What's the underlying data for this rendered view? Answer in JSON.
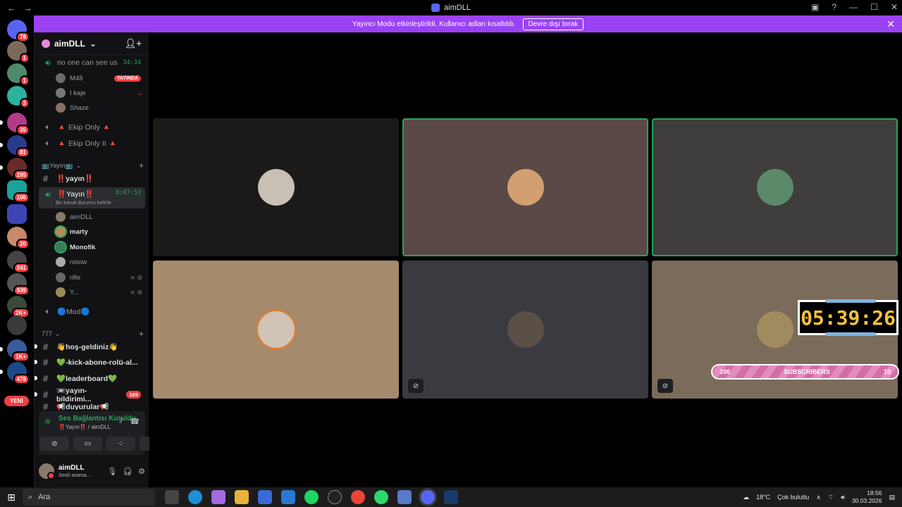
{
  "window": {
    "title": "aimDLL",
    "back": "←",
    "forward": "→",
    "controls": [
      "▣",
      "?",
      "—",
      "☐",
      "✕"
    ]
  },
  "banner": {
    "message": "Yayıncı Modu etkinleştirildi. Kullanıcı adları kısaltıldı.",
    "button": "Devre dışı bırak",
    "close": "✕"
  },
  "servers": {
    "badges": [
      "78",
      "1",
      "1",
      "3",
      "35",
      "81",
      "295",
      "106",
      "20",
      "241",
      "939",
      "2K+",
      "1K+",
      "478"
    ],
    "new_label": "YENİ"
  },
  "guild": {
    "name": "aimDLL",
    "chevron": "⌄",
    "invite_icon": "person-add-icon"
  },
  "channels": {
    "voice1": {
      "name": "no one can see us",
      "timer": "34:34"
    },
    "voice1_users": [
      {
        "name": "M48",
        "live": "YAYINDA"
      },
      {
        "name": "I kaje"
      },
      {
        "name": "Shaze"
      }
    ],
    "voice2": {
      "name": "🔺 Ekip Only 🔺"
    },
    "voice3": {
      "name": "🔺 Ekip Only II 🔺"
    },
    "cat1": {
      "name": "📺Yayın📺"
    },
    "text_yayin": {
      "name": "‼️yayın‼️"
    },
    "voice_active": {
      "name": "‼️Yayın‼️",
      "timer": "8:07:53",
      "status": "Bir kanal durumu belirle"
    },
    "active_users": [
      {
        "name": "aimDLL"
      },
      {
        "name": "marty"
      },
      {
        "name": "Monofik"
      },
      {
        "name": "nisow"
      },
      {
        "name": "rifle"
      },
      {
        "name": "Y..."
      }
    ],
    "voice_mod": {
      "name": "🔵Mod🔵"
    },
    "cat2": {
      "name": "777"
    },
    "text_list": [
      {
        "name": "👋hoş-geldiniz👋"
      },
      {
        "name": "💚-kick-abone-rolü-al..."
      },
      {
        "name": "💚leaderboard💚"
      },
      {
        "name": "📼yayın-bildirimi...",
        "count": "105"
      },
      {
        "name": "📢duyurular📢"
      }
    ]
  },
  "voice_panel": {
    "status": "Ses Bağlantısı Kuruldu",
    "channel": "‼️Yayın‼️ / aimDLL",
    "buttons": [
      "camera-off-icon",
      "screen-share-icon",
      "activities-icon",
      "soundboard-icon"
    ]
  },
  "user_panel": {
    "name": "aimDLL",
    "status": "Sesli arama..."
  },
  "overlay": {
    "clock": "05:39:26",
    "subs_left": "200",
    "subs_label": "SUBSCRIBERS",
    "subs_right": "10"
  },
  "taskbar": {
    "search": "Ara",
    "weather_temp": "18°C",
    "weather_desc": "Çok bulutlu",
    "time": "18:56",
    "date": "30.03.2026"
  },
  "colors": {
    "accent": "#5865f2",
    "banner": "#9b42f5",
    "speaking": "#23a55a",
    "danger": "#f23f43"
  }
}
